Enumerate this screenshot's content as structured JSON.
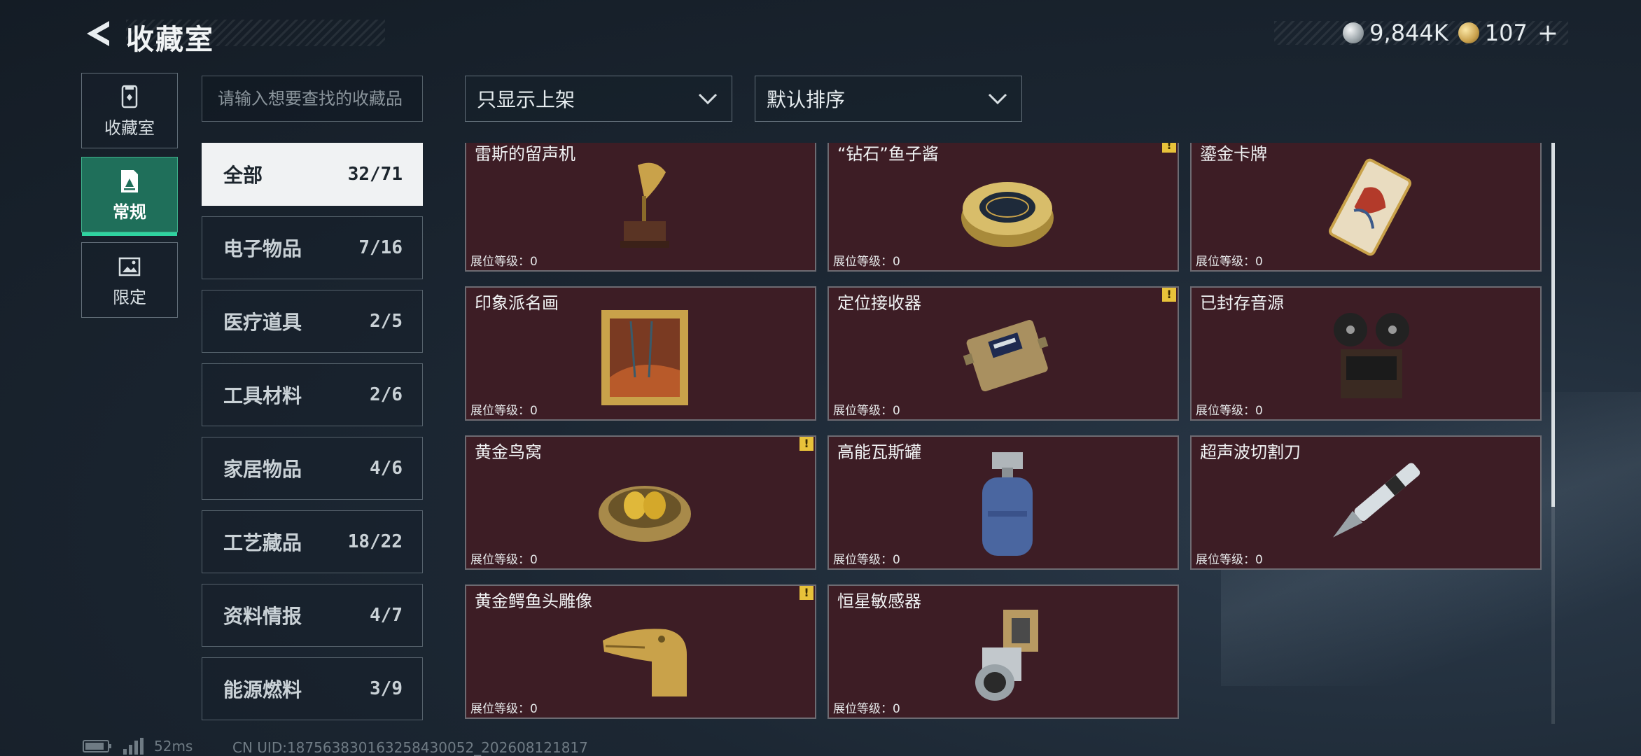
{
  "header": {
    "title": "收藏室",
    "currencies": [
      {
        "icon": "silver-coin-icon",
        "value": "9,844K"
      },
      {
        "icon": "gold-coin-icon",
        "value": "107"
      }
    ],
    "plus_label": "+"
  },
  "side_tabs": [
    {
      "label": "收藏室",
      "icon": "collection-room-icon",
      "active": false
    },
    {
      "label": "常规",
      "icon": "regular-document-icon",
      "active": true
    },
    {
      "label": "限定",
      "icon": "limited-image-icon",
      "active": false
    }
  ],
  "search": {
    "placeholder": "请输入想要查找的收藏品",
    "value": ""
  },
  "filters": {
    "display_filter": "只显示上架",
    "sort_order": "默认排序"
  },
  "categories": [
    {
      "name": "全部",
      "count": "32/71",
      "active": true
    },
    {
      "name": "电子物品",
      "count": "7/16",
      "active": false
    },
    {
      "name": "医疗道具",
      "count": "2/5",
      "active": false
    },
    {
      "name": "工具材料",
      "count": "2/6",
      "active": false
    },
    {
      "name": "家居物品",
      "count": "4/6",
      "active": false
    },
    {
      "name": "工艺藏品",
      "count": "18/22",
      "active": false
    },
    {
      "name": "资料情报",
      "count": "4/7",
      "active": false
    },
    {
      "name": "能源燃料",
      "count": "3/9",
      "active": false
    }
  ],
  "items": [
    {
      "name": "雷斯的留声机",
      "level": "展位等级：0",
      "warning": false,
      "art": "gramophone"
    },
    {
      "name": "“钻石”鱼子酱",
      "level": "展位等级：0",
      "warning": true,
      "art": "caviar"
    },
    {
      "name": "鎏金卡牌",
      "level": "展位等级：0",
      "warning": false,
      "art": "card"
    },
    {
      "name": "印象派名画",
      "level": "展位等级：0",
      "warning": false,
      "art": "painting"
    },
    {
      "name": "定位接收器",
      "level": "展位等级：0",
      "warning": true,
      "art": "receiver"
    },
    {
      "name": "已封存音源",
      "level": "展位等级：0",
      "warning": false,
      "art": "reel"
    },
    {
      "name": "黄金鸟窝",
      "level": "展位等级：0",
      "warning": true,
      "art": "nest"
    },
    {
      "name": "高能瓦斯罐",
      "level": "展位等级：0",
      "warning": false,
      "art": "gas"
    },
    {
      "name": "超声波切割刀",
      "level": "展位等级：0",
      "warning": false,
      "art": "knife"
    },
    {
      "name": "黄金鳄鱼头雕像",
      "level": "展位等级：0",
      "warning": true,
      "art": "croc"
    },
    {
      "name": "恒星敏感器",
      "level": "展位等级：0",
      "warning": false,
      "art": "sensor"
    }
  ],
  "warning_glyph": "!",
  "status": {
    "ping": "52ms",
    "uid": "CN UID:18756383016325843005​2_202608121817"
  },
  "colors": {
    "accent": "#2fd3a0",
    "card_bg": "#3d1d25",
    "warning": "#e8c23a"
  }
}
